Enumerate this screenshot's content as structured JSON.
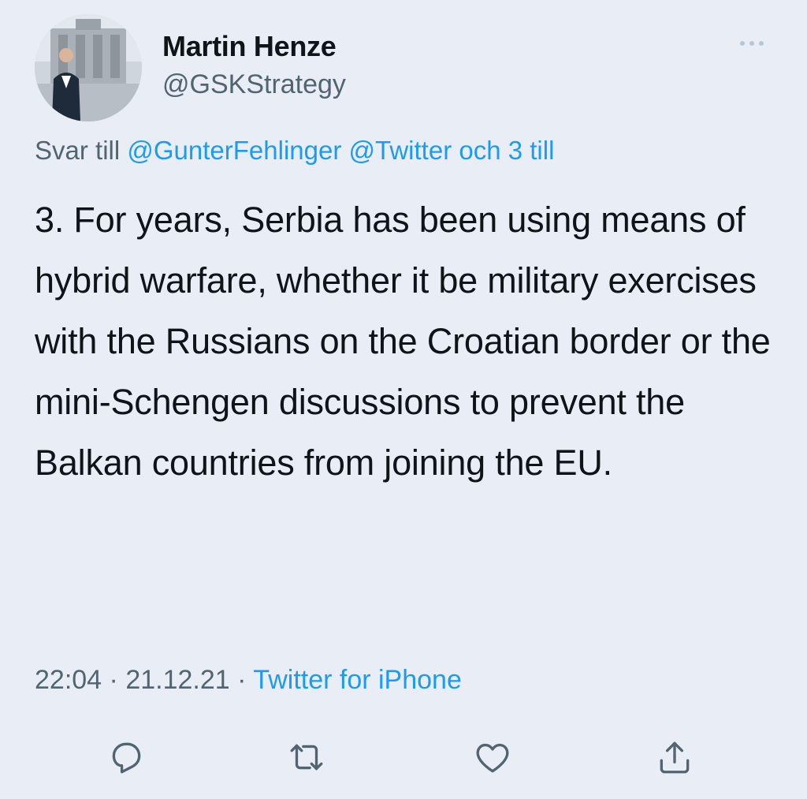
{
  "author": {
    "name": "Martin Henze",
    "handle": "@GSKStrategy"
  },
  "reply_context": {
    "prefix": "Svar till",
    "mentions": [
      "@GunterFehlinger",
      "@Twitter"
    ],
    "suffix": "och 3 till"
  },
  "tweet": {
    "text": "3. For years, Serbia has been using means of hybrid warfare, whether it be military exercises with the Russians on the Croatian border or the mini-Schengen discussions to prevent the Balkan countries from joining the EU."
  },
  "meta": {
    "time": "22:04",
    "separator": "·",
    "date": "21.12.21",
    "source": "Twitter for iPhone"
  },
  "icons": {
    "more": "more-horizontal-icon",
    "reply": "reply-icon",
    "retweet": "retweet-icon",
    "like": "heart-icon",
    "share": "share-icon"
  },
  "colors": {
    "accent": "#1d9bf0",
    "background": "#e9eef6",
    "secondary_text": "#536471",
    "primary_text": "#0f1419"
  }
}
